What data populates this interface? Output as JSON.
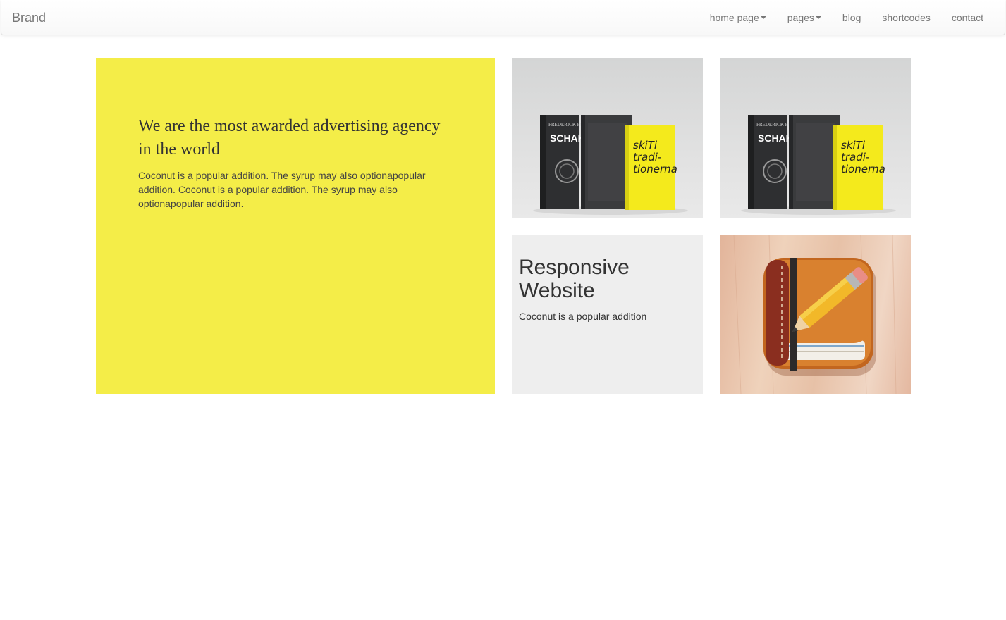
{
  "navbar": {
    "brand": "Brand",
    "items": [
      {
        "label": "home page",
        "dropdown": true
      },
      {
        "label": "pages",
        "dropdown": true
      },
      {
        "label": "blog",
        "dropdown": false
      },
      {
        "label": "shortcodes",
        "dropdown": false
      },
      {
        "label": "contact",
        "dropdown": false
      }
    ]
  },
  "feature": {
    "heading": "We are the most awarded advertising agency in the world",
    "body": "Coconut is a popular addition. The syrup may also optionapopular addition. Coconut is a popular addition. The syrup may also optionapopular addition."
  },
  "responsive": {
    "heading": "Responsive Website",
    "body": "Coconut is a popular addition"
  },
  "books_image": {
    "book1_author": "FREDERICK FORSYTH",
    "book1_title": "SCHAKALEN",
    "book3_title_lines": [
      "skiTi",
      "tradi-",
      "tionerna"
    ]
  },
  "colors": {
    "feature_bg": "#f4ed48",
    "card_bg": "#eeeeee",
    "nav_text": "#777777"
  }
}
